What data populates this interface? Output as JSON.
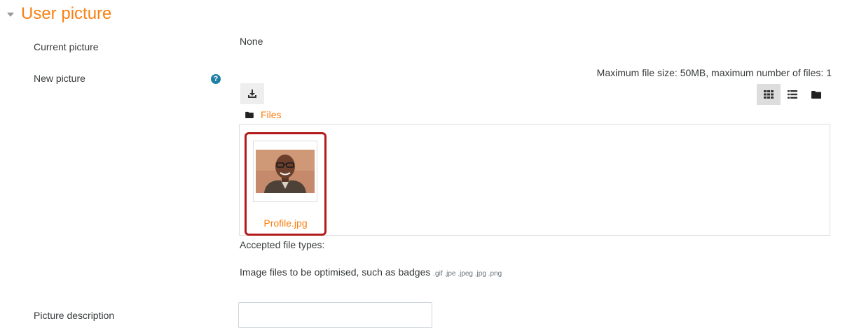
{
  "section": {
    "title": "User picture"
  },
  "current_picture": {
    "label": "Current picture",
    "value": "None"
  },
  "new_picture": {
    "label": "New picture",
    "help_glyph": "?",
    "max_info": "Maximum file size: 50MB, maximum number of files: 1",
    "path": "Files",
    "files": [
      {
        "name": "Profile.jpg"
      }
    ],
    "accepted_label": "Accepted file types:",
    "accepted_desc": "Image files to be optimised, such as badges",
    "extensions": ".gif .jpe .jpeg .jpg .png"
  },
  "picture_description": {
    "label": "Picture description",
    "value": ""
  },
  "colors": {
    "accent": "#f98012",
    "help": "#1f7fa7",
    "selection_border": "#b31b1b"
  },
  "icons": [
    "caret-down-icon",
    "help-icon",
    "download-icon",
    "grid-view-icon",
    "list-view-icon",
    "folder-view-icon",
    "folder-icon"
  ]
}
